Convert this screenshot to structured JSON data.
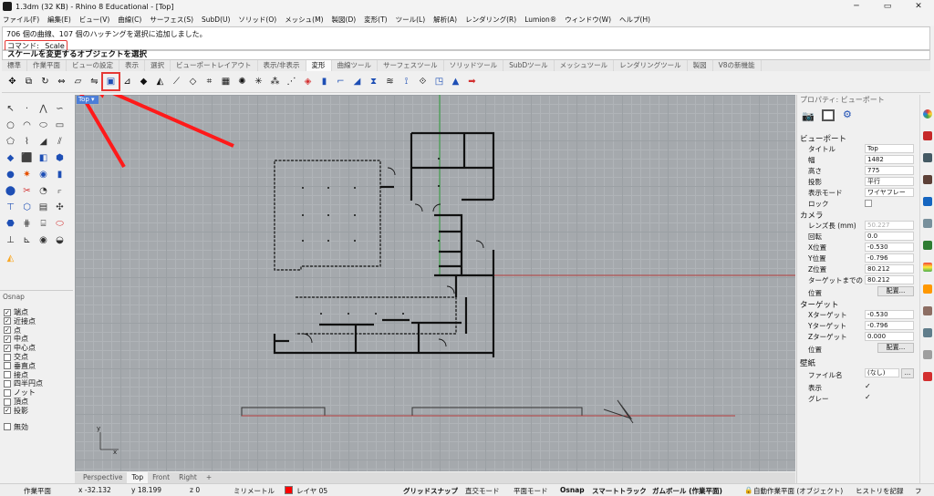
{
  "window": {
    "title": "1.3dm (32 KB) - Rhino 8 Educational - [Top]",
    "controls": [
      "─",
      "▭",
      "✕"
    ]
  },
  "menu": [
    "ファイル(F)",
    "編集(E)",
    "ビュー(V)",
    "曲線(C)",
    "サーフェス(S)",
    "SubD(U)",
    "ソリッド(O)",
    "メッシュ(M)",
    "製図(D)",
    "変形(T)",
    "ツール(L)",
    "解析(A)",
    "レンダリング(R)",
    "Lumion®",
    "ウィンドウ(W)",
    "ヘルプ(H)"
  ],
  "command": {
    "history_line": "706 個の曲線、107 個のハッチングを選択に追加しました。",
    "command_line": "コマンド: _Scale",
    "prompt": "スケールを変更するオブジェクトを選択"
  },
  "tabs": [
    "標準",
    "作業平面",
    "ビューの設定",
    "表示",
    "選択",
    "ビューポートレイアウト",
    "表示/非表示",
    "変形",
    "曲線ツール",
    "サーフェスツール",
    "ソリッドツール",
    "SubDツール",
    "メッシュツール",
    "レンダリングツール",
    "製図",
    "V8の新機能"
  ],
  "active_tab": "変形",
  "viewport": {
    "name": "Top",
    "axis_y": "y",
    "axis_x": "x",
    "tabs": [
      "Perspective",
      "Top",
      "Front",
      "Right"
    ],
    "active_tab": "Top",
    "add_tab": "+"
  },
  "osnap": {
    "header": "Osnap",
    "items": [
      {
        "label": "端点",
        "checked": true
      },
      {
        "label": "近接点",
        "checked": true
      },
      {
        "label": "点",
        "checked": true
      },
      {
        "label": "中点",
        "checked": true
      },
      {
        "label": "中心点",
        "checked": true
      },
      {
        "label": "交点",
        "checked": false
      },
      {
        "label": "垂直点",
        "checked": false
      },
      {
        "label": "接点",
        "checked": false
      },
      {
        "label": "四半円点",
        "checked": false
      },
      {
        "label": "ノット",
        "checked": false
      },
      {
        "label": "頂点",
        "checked": false
      },
      {
        "label": "投影",
        "checked": true
      }
    ],
    "disable": "無効"
  },
  "properties": {
    "title": "プロパティ: ビューポート",
    "viewport_section": "ビューポート",
    "title_label": "タイトル",
    "title_value": "Top",
    "width_label": "幅",
    "width_value": "1482",
    "height_label": "高さ",
    "height_value": "775",
    "projection_label": "投影",
    "projection_value": "平行",
    "display_label": "表示モード",
    "display_value": "ワイヤフレー",
    "lock_label": "ロック",
    "camera_section": "カメラ",
    "lens_label": "レンズ長 (mm)",
    "lens_value": "50.227",
    "rotation_label": "回転",
    "rotation_value": "0.0",
    "xpos_label": "X位置",
    "xpos_value": "-0.530",
    "ypos_label": "Y位置",
    "ypos_value": "-0.796",
    "zpos_label": "Z位置",
    "zpos_value": "80.212",
    "target_dist_label": "ターゲットまでの",
    "target_dist_value": "80.212",
    "position_label": "位置",
    "place_button": "配置...",
    "target_section": "ターゲット",
    "xtarget_label": "Xターゲット",
    "xtarget_value": "-0.530",
    "ytarget_label": "Yターゲット",
    "ytarget_value": "-0.796",
    "ztarget_label": "Zターゲット",
    "ztarget_value": "0.000",
    "target_position_label": "位置",
    "target_place_button": "配置...",
    "wallpaper_section": "壁紙",
    "file_label": "ファイル名",
    "file_value": "(なし)",
    "file_button": "...",
    "show_label": "表示",
    "gray_label": "グレー",
    "checkmark": "✓"
  },
  "status": {
    "cplane": "作業平面",
    "x": "x -32.132",
    "y": "y 18.199",
    "z": "z 0",
    "unit": "ミリメートル",
    "layer": "レイヤ 05",
    "layer_color": "#ff0000",
    "grid_snap": "グリッドスナップ",
    "ortho": "直交モード",
    "planar": "平面モード",
    "osnap": "Osnap",
    "smart_track": "スマートトラック",
    "gumball": "ガムボール (作業平面)",
    "auto_cplane": "自動作業平面 (オブジェクト)",
    "history": "ヒストリを記録",
    "filter": "フ"
  }
}
